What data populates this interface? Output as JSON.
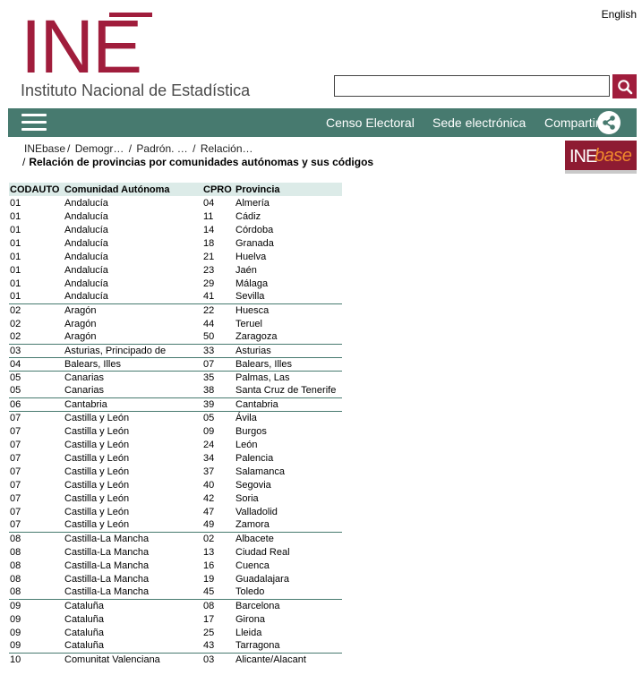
{
  "header": {
    "language_link": "English",
    "logo_word": "INE",
    "logo_subtitle": "Instituto Nacional de Estadística",
    "search_value": "",
    "brand_color": "#a01d3c"
  },
  "nav": {
    "menu_icon": "hamburger-menu-icon",
    "links": [
      "Censo Electoral",
      "Sede electrónica",
      "Compartir"
    ],
    "share_icon": "share-icon",
    "bar_color": "#477a6f"
  },
  "breadcrumb": {
    "items": [
      "INEbase",
      "Demogr…",
      "Padrón. …",
      "Relación…"
    ],
    "current": "Relación de provincias por comunidades autónomas y sus códigos"
  },
  "inebase_logo": {
    "ine": "INE",
    "base": "base"
  },
  "table": {
    "headers": [
      "CODAUTO",
      "Comunidad Autónoma",
      "CPRO",
      "Provincia"
    ],
    "rows": [
      [
        "01",
        "Andalucía",
        "04",
        "Almería"
      ],
      [
        "01",
        "Andalucía",
        "11",
        "Cádiz"
      ],
      [
        "01",
        "Andalucía",
        "14",
        "Córdoba"
      ],
      [
        "01",
        "Andalucía",
        "18",
        "Granada"
      ],
      [
        "01",
        "Andalucía",
        "21",
        "Huelva"
      ],
      [
        "01",
        "Andalucía",
        "23",
        "Jaén"
      ],
      [
        "01",
        "Andalucía",
        "29",
        "Málaga"
      ],
      [
        "01",
        "Andalucía",
        "41",
        "Sevilla"
      ],
      [
        "02",
        "Aragón",
        "22",
        "Huesca"
      ],
      [
        "02",
        "Aragón",
        "44",
        "Teruel"
      ],
      [
        "02",
        "Aragón",
        "50",
        "Zaragoza"
      ],
      [
        "03",
        "Asturias, Principado de",
        "33",
        "Asturias"
      ],
      [
        "04",
        "Balears, Illes",
        "07",
        "Balears, Illes"
      ],
      [
        "05",
        "Canarias",
        "35",
        "Palmas, Las"
      ],
      [
        "05",
        "Canarias",
        "38",
        "Santa Cruz de Tenerife"
      ],
      [
        "06",
        "Cantabria",
        "39",
        "Cantabria"
      ],
      [
        "07",
        "Castilla y León",
        "05",
        "Ávila"
      ],
      [
        "07",
        "Castilla y León",
        "09",
        "Burgos"
      ],
      [
        "07",
        "Castilla y León",
        "24",
        "León"
      ],
      [
        "07",
        "Castilla y León",
        "34",
        "Palencia"
      ],
      [
        "07",
        "Castilla y León",
        "37",
        "Salamanca"
      ],
      [
        "07",
        "Castilla y León",
        "40",
        "Segovia"
      ],
      [
        "07",
        "Castilla y León",
        "42",
        "Soria"
      ],
      [
        "07",
        "Castilla y León",
        "47",
        "Valladolid"
      ],
      [
        "07",
        "Castilla y León",
        "49",
        "Zamora"
      ],
      [
        "08",
        "Castilla-La Mancha",
        "02",
        "Albacete"
      ],
      [
        "08",
        "Castilla-La Mancha",
        "13",
        "Ciudad Real"
      ],
      [
        "08",
        "Castilla-La Mancha",
        "16",
        "Cuenca"
      ],
      [
        "08",
        "Castilla-La Mancha",
        "19",
        "Guadalajara"
      ],
      [
        "08",
        "Castilla-La Mancha",
        "45",
        "Toledo"
      ],
      [
        "09",
        "Cataluña",
        "08",
        "Barcelona"
      ],
      [
        "09",
        "Cataluña",
        "17",
        "Girona"
      ],
      [
        "09",
        "Cataluña",
        "25",
        "Lleida"
      ],
      [
        "09",
        "Cataluña",
        "43",
        "Tarragona"
      ],
      [
        "10",
        "Comunitat Valenciana",
        "03",
        "Alicante/Alacant"
      ]
    ]
  }
}
